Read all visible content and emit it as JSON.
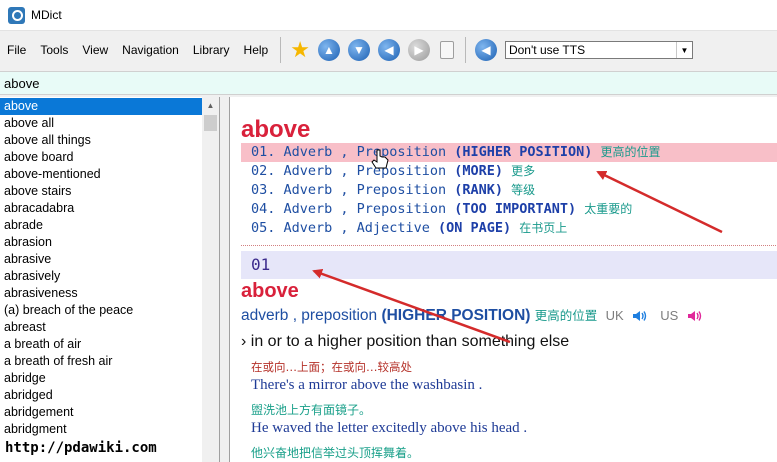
{
  "window": {
    "title": "MDict"
  },
  "menu": [
    "File",
    "Tools",
    "View",
    "Navigation",
    "Library",
    "Help"
  ],
  "toolbar": {
    "tts_value": "Don't use TTS"
  },
  "search": {
    "value": "above"
  },
  "wordlist": [
    "above",
    "above all",
    "above all things",
    "above board",
    "above-mentioned",
    "above stairs",
    "abracadabra",
    "abrade",
    "abrasion",
    "abrasive",
    "abrasively",
    "abrasiveness",
    "(a) breach of the peace",
    "abreast",
    "a breath of air",
    "a breath of fresh air",
    "abridge",
    "abridged",
    "abridgement",
    "abridgment"
  ],
  "entry": {
    "headword": "above",
    "senses": [
      {
        "num": "01.",
        "pos": "Adverb , Preposition",
        "kw": "(HIGHER POSITION)",
        "zh": "更高的位置"
      },
      {
        "num": "02.",
        "pos": "Adverb , Preposition",
        "kw": "(MORE)",
        "zh": "更多"
      },
      {
        "num": "03.",
        "pos": "Adverb , Preposition",
        "kw": "(RANK)",
        "zh": "等级"
      },
      {
        "num": "04.",
        "pos": "Adverb , Preposition",
        "kw": "(TOO IMPORTANT)",
        "zh": "太重要的"
      },
      {
        "num": "05.",
        "pos": "Adverb , Adjective",
        "kw": "(ON PAGE)",
        "zh": "在书页上"
      }
    ],
    "section_number": "01",
    "section_headword": "above",
    "section_pos": "adverb , preposition",
    "section_kw": "(HIGHER POSITION)",
    "section_zh": "更高的位置",
    "pron_uk": "UK",
    "pron_us": "US",
    "definition_marker": "›",
    "definition": "in or to a higher position than something else",
    "definition_zh": "在或向…上面；在或向…较高处",
    "examples": [
      {
        "en": "There's a mirror above the washbasin .",
        "zh": "盥洗池上方有面镜子。"
      },
      {
        "en": "He waved the letter excitedly above his head .",
        "zh": "他兴奋地把信举过头顶挥舞着。"
      }
    ]
  },
  "watermark": "http://pdawiki.com",
  "colors": {
    "headword": "#d9213b",
    "highlight_row": "#f8bfc8",
    "sense_text": "#1e4ea2",
    "chinese": "#1a9a8c",
    "annotation_arrow": "#d42b2b",
    "search_bg": "#e8fbf7",
    "selection": "#0a78d7"
  },
  "icons": {
    "app": "mdict-app-icon",
    "favorite": "star-icon",
    "up": "arrow-up-icon",
    "down": "arrow-down-icon",
    "back": "arrow-left-icon",
    "forward": "arrow-right-icon",
    "clipboard": "clipboard-icon",
    "tts": "speaker-icon"
  }
}
